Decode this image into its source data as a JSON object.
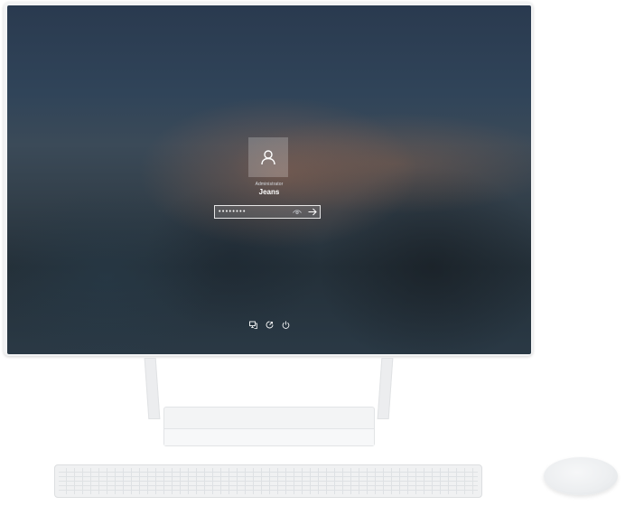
{
  "lock_screen": {
    "user_role": "Administrator",
    "user_name": "Jeans",
    "password_masked": "••••••••",
    "icons": {
      "avatar": "user-icon",
      "reveal": "eye-icon",
      "submit": "arrow-right-icon",
      "network": "network-icon",
      "accessibility": "accessibility-icon",
      "power": "power-icon"
    }
  }
}
